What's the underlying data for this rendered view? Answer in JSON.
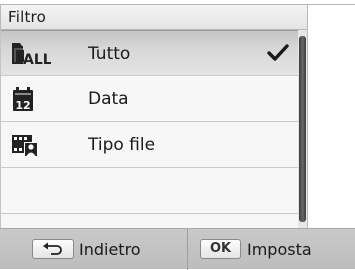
{
  "header": {
    "title": "Filtro"
  },
  "menu": {
    "items": [
      {
        "label": "Tutto",
        "icon": "all-files-icon",
        "selected": true
      },
      {
        "label": "Data",
        "icon": "calendar-icon",
        "selected": false
      },
      {
        "label": "Tipo file",
        "icon": "file-type-icon",
        "selected": false
      }
    ]
  },
  "footer": {
    "back_key": "back-arrow-icon",
    "back_label": "Indietro",
    "ok_key": "OK",
    "ok_label": "Imposta"
  },
  "colors": {
    "selected_row": "#d7d7d7",
    "bottom_bar": "#c2c2c2",
    "scroll_thumb": "#4a4a4a"
  }
}
